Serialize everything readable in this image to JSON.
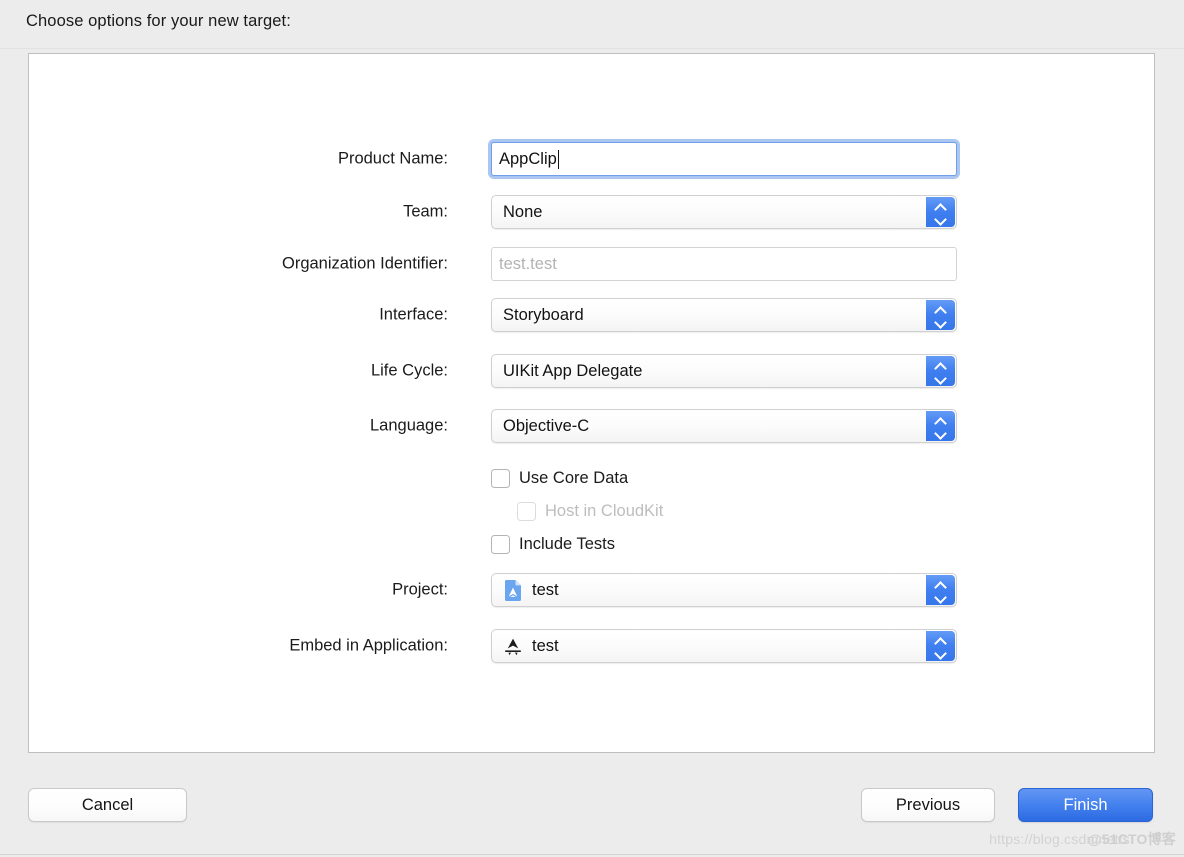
{
  "dialog": {
    "title": "Choose options for your new target:"
  },
  "form": {
    "rows": [
      {
        "label": "Product Name:",
        "type": "textfield",
        "value": "AppClip",
        "focused": true
      },
      {
        "label": "Team:",
        "type": "popup",
        "value": "None"
      },
      {
        "label": "Organization Identifier:",
        "type": "textfield",
        "value": "",
        "placeholder": "test.test"
      },
      {
        "label": "Interface:",
        "type": "popup",
        "value": "Storyboard"
      },
      {
        "label": "Life Cycle:",
        "type": "popup",
        "value": "UIKit App Delegate"
      },
      {
        "label": "Language:",
        "type": "popup",
        "value": "Objective-C"
      }
    ],
    "checkboxes": [
      {
        "label": "Use Core Data",
        "checked": false,
        "disabled": false,
        "indented": false
      },
      {
        "label": "Host in CloudKit",
        "checked": false,
        "disabled": true,
        "indented": true
      },
      {
        "label": "Include Tests",
        "checked": false,
        "disabled": false,
        "indented": false
      }
    ],
    "project_row": {
      "label": "Project:",
      "value": "test",
      "icon": "xcode-project-document-icon"
    },
    "embed_row": {
      "label": "Embed in Application:",
      "value": "test",
      "icon": "app-store-a-icon"
    }
  },
  "buttons": {
    "cancel": "Cancel",
    "previous": "Previous",
    "finish": "Finish"
  },
  "watermark": {
    "url": "https://blog.csdn.net/s",
    "tag": "@51CTO博客"
  },
  "colors": {
    "window_background": "#ececec",
    "panel_background": "#ffffff",
    "accent_blue": "#3f7ff0",
    "focus_ring": "#6699e6",
    "primary_button": "#4783ef",
    "disabled_text": "#bdbdbd",
    "placeholder_text": "#b3b3b3"
  }
}
